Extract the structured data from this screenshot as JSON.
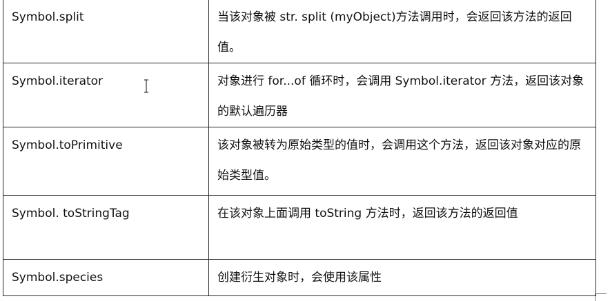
{
  "table": {
    "rows": [
      {
        "name": "Symbol.split",
        "description": "当该对象被 str. split (myObject)方法调用时，会返回该方法的返回值。"
      },
      {
        "name": "Symbol.iterator",
        "description": "对象进行 for...of 循环时，会调用 Symbol.iterator 方法，返回该对象的默认遍历器"
      },
      {
        "name": "Symbol.toPrimitive",
        "description": "该对象被转为原始类型的值时，会调用这个方法，返回该对象对应的原始类型值。"
      },
      {
        "name": "Symbol. toStringTag",
        "description": "在该对象上面调用 toString 方法时，返回该方法的返回值"
      },
      {
        "name": "Symbol.species",
        "description": "创建衍生对象时，会使用该属性"
      }
    ]
  },
  "icons": {
    "cursor": "text-cursor-icon"
  }
}
